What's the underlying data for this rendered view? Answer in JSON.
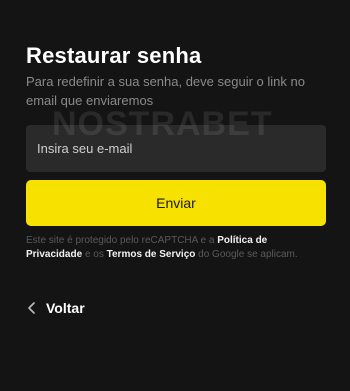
{
  "title": "Restaurar senha",
  "subtitle": "Para redefinir a sua senha, deve seguir o link no email que enviaremos",
  "email_field": {
    "placeholder": "Insira seu e-mail",
    "value": ""
  },
  "watermark": "NOSTRABET",
  "submit_label": "Enviar",
  "legal": {
    "line_start": "Este site é protegido pelo reCAPTCHA e a",
    "privacy_link": "Política de Privacidade",
    "connector": "e os",
    "terms_link": "Termos de Serviço",
    "line_end": "do Google se aplicam."
  },
  "back_label": "Voltar",
  "colors": {
    "background": "#141414",
    "accent": "#f7e100",
    "field_background": "#2a2a2a"
  },
  "icons": {
    "back": "chevron-left-icon"
  }
}
